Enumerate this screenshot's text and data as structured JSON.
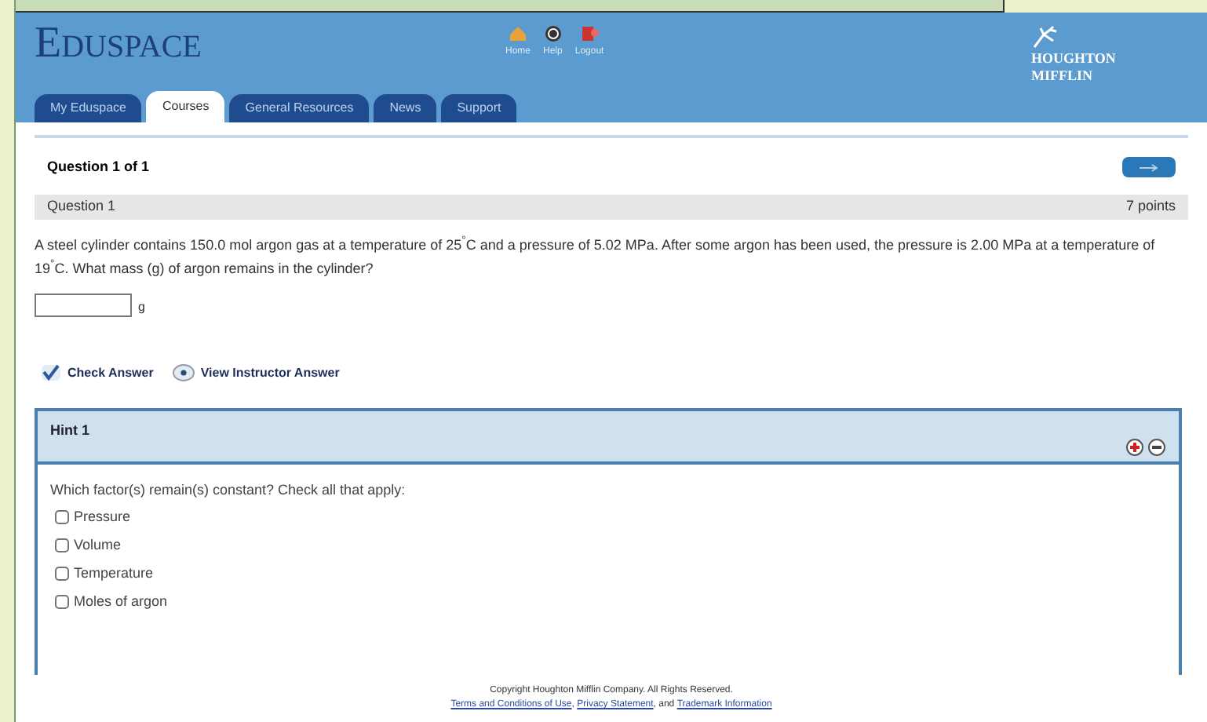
{
  "header": {
    "logo": "Eduspace",
    "nav_links": [
      "Home",
      "Help",
      "Logout"
    ],
    "publisher": [
      "HOUGHTON",
      "MIFFLIN"
    ]
  },
  "tabs": [
    {
      "label": "My Eduspace",
      "selected": false
    },
    {
      "label": "Courses",
      "selected": true
    },
    {
      "label": "General Resources",
      "selected": false
    },
    {
      "label": "News",
      "selected": false
    },
    {
      "label": "Support",
      "selected": false
    }
  ],
  "question_heading": "Question 1 of 1",
  "question_bar": {
    "title": "Question 1",
    "points": "7 points"
  },
  "question_text": "A steel cylinder contains 150.0 mol argon gas at a temperature of 25$^{°}$C and a pressure of 5.02 MPa. After some argon has been used, the pressure is 2.00 MPa at a temperature of 19$^{°}$C. What mass (g) of argon remains in the cylinder?",
  "answer": {
    "unit": "g"
  },
  "actions": [
    {
      "kind": "check",
      "label": "Check Answer"
    },
    {
      "kind": "view",
      "label": "View Instructor Answer"
    }
  ],
  "hint": {
    "title": "Hint 1",
    "prompt": "Which factor(s) remain(s) constant? Check all that apply:",
    "options": [
      {
        "label": "Pressure",
        "checked": false
      },
      {
        "label": "Volume",
        "checked": false
      },
      {
        "label": "Temperature",
        "checked": false
      },
      {
        "label": "Moles of argon",
        "checked": false
      }
    ]
  },
  "footer": {
    "copyright": "Copyright Houghton Mifflin Company. All Rights Reserved.",
    "links": [
      {
        "kind": "link",
        "text": "Terms and Conditions of Use"
      },
      {
        "kind": "text",
        "text": ", "
      },
      {
        "kind": "link",
        "text": "Privacy Statement"
      },
      {
        "kind": "text",
        "text": ", and "
      },
      {
        "kind": "link",
        "text": "Trademark Information"
      }
    ]
  }
}
